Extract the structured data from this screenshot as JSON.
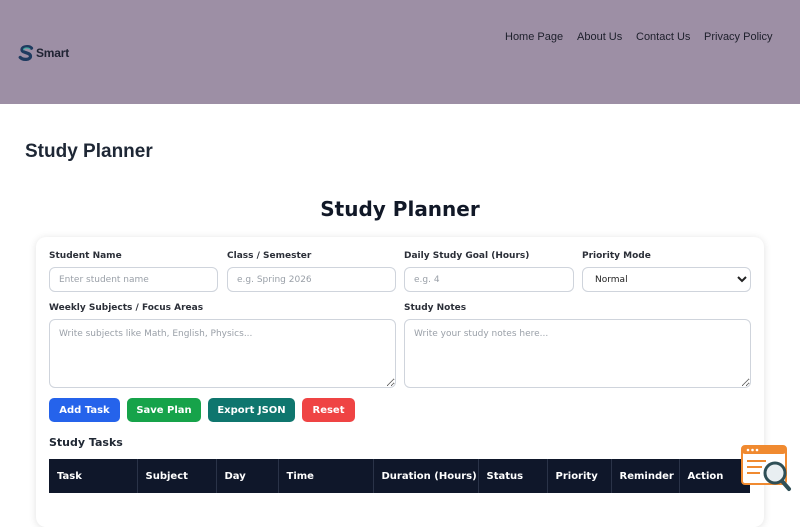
{
  "header": {
    "logo_text": "Smart",
    "nav": [
      "Home Page",
      "About Us",
      "Contact Us",
      "Privacy Policy"
    ]
  },
  "page_title": "Study Planner",
  "planner": {
    "title": "Study Planner",
    "fields": {
      "student_name": {
        "label": "Student Name",
        "placeholder": "Enter student name"
      },
      "class_semester": {
        "label": "Class / Semester",
        "placeholder": "e.g. Spring 2026"
      },
      "daily_goal": {
        "label": "Daily Study Goal (Hours)",
        "placeholder": "e.g. 4"
      },
      "priority_mode": {
        "label": "Priority Mode",
        "value": "Normal"
      },
      "weekly_subjects": {
        "label": "Weekly Subjects / Focus Areas",
        "placeholder": "Write subjects like Math, English, Physics..."
      },
      "study_notes": {
        "label": "Study Notes",
        "placeholder": "Write your study notes here..."
      }
    },
    "buttons": {
      "add_task": "Add Task",
      "save_plan": "Save Plan",
      "export_json": "Export JSON",
      "reset": "Reset"
    },
    "tasks_title": "Study Tasks",
    "table_headers": [
      "Task",
      "Subject",
      "Day",
      "Time",
      "Duration (Hours)",
      "Status",
      "Priority",
      "Reminder",
      "Action"
    ]
  },
  "colors": {
    "header_bg": "#9d8fa5",
    "add_task": "#2563eb",
    "save_plan": "#16a34a",
    "export_json": "#0f766e",
    "reset": "#ef4444",
    "table_header": "#0f172a"
  },
  "icons": {
    "logo": "s-logo-icon",
    "chat": "chat-search-icon"
  }
}
